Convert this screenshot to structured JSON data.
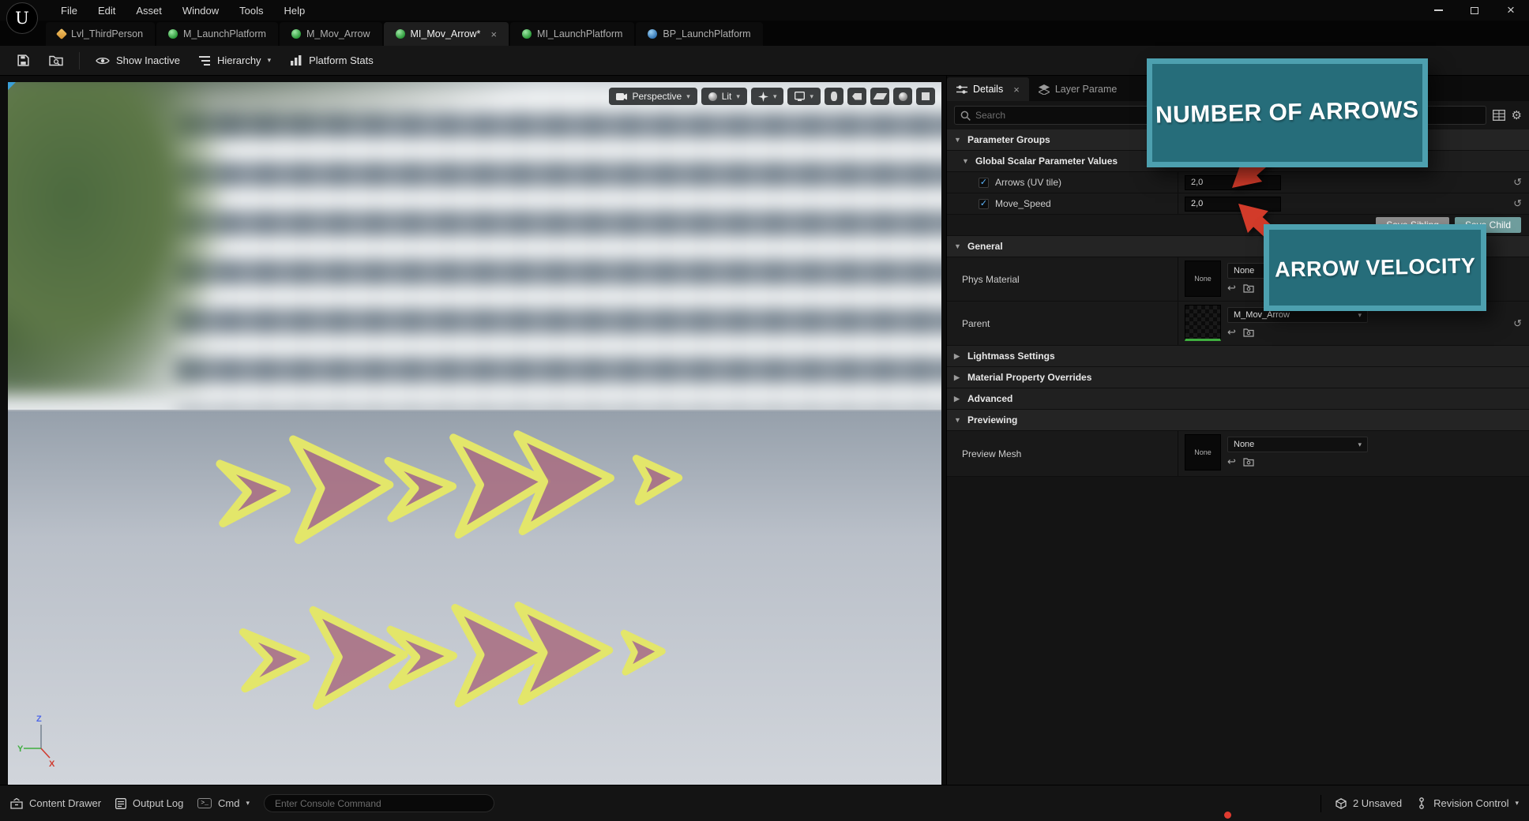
{
  "glyphs": {
    "check": "✓",
    "caret_down": "▾",
    "section_expanded": "▼",
    "section_collapsed": "▶",
    "close": "×",
    "reset": "↺",
    "use_selected": "↩",
    "gear": "⚙",
    "window_close": "×",
    "cmd_prompt": ">_",
    "logo": "U"
  },
  "menu": {
    "items": [
      "File",
      "Edit",
      "Asset",
      "Window",
      "Tools",
      "Help"
    ]
  },
  "tabs": [
    {
      "label": "Lvl_ThirdPerson"
    },
    {
      "label": "M_LaunchPlatform"
    },
    {
      "label": "M_Mov_Arrow"
    },
    {
      "label": "MI_Mov_Arrow*"
    },
    {
      "label": "MI_LaunchPlatform"
    },
    {
      "label": "BP_LaunchPlatform"
    }
  ],
  "toolbar": {
    "show_inactive": "Show Inactive",
    "hierarchy": "Hierarchy",
    "platform_stats": "Platform Stats"
  },
  "viewport": {
    "perspective": "Perspective",
    "lit": "Lit",
    "axis": {
      "x": "X",
      "y": "Y",
      "z": "Z"
    }
  },
  "details": {
    "tab_details": "Details",
    "tab_layer_params": "Layer Parame",
    "search_placeholder": "Search",
    "sections": {
      "parameter_groups": "Parameter Groups",
      "global_scalar": "Global Scalar Parameter Values",
      "general": "General",
      "lightmass": "Lightmass Settings",
      "material_overrides": "Material Property Overrides",
      "advanced": "Advanced",
      "previewing": "Previewing"
    },
    "params": [
      {
        "label": "Arrows (UV tile)",
        "value": "2,0"
      },
      {
        "label": "Move_Speed",
        "value": "2,0"
      }
    ],
    "buttons": {
      "save_sibling": "Save Sibling",
      "save_child": "Save Child"
    },
    "rows": {
      "phys_material": {
        "label": "Phys Material",
        "thumb": "None",
        "value": "None"
      },
      "parent": {
        "label": "Parent",
        "value": "M_Mov_Arrow"
      },
      "preview_mesh": {
        "label": "Preview Mesh",
        "thumb": "None",
        "value": "None"
      }
    }
  },
  "callouts": {
    "number_of_arrows": "NUMBER OF ARROWS",
    "arrow_velocity": "ARROW VELOCITY"
  },
  "statusbar": {
    "content_drawer": "Content Drawer",
    "output_log": "Output Log",
    "cmd": "Cmd",
    "console_placeholder": "Enter Console Command",
    "unsaved": "2 Unsaved",
    "revision_control": "Revision Control"
  }
}
